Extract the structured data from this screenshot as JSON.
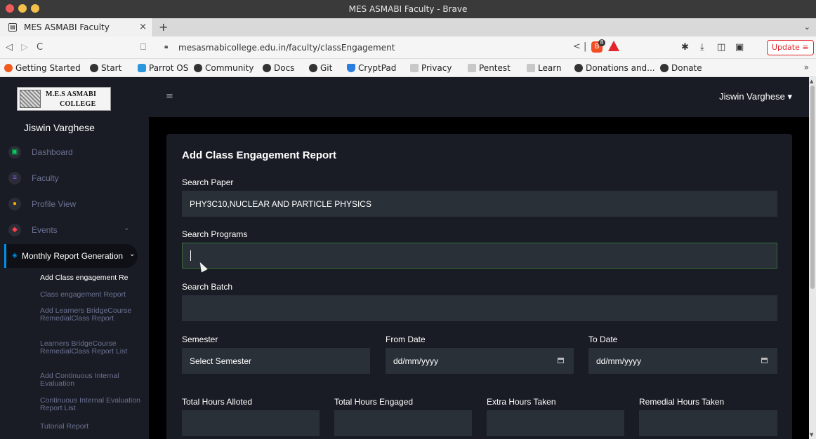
{
  "window": {
    "title": "MES ASMABI Faculty - Brave"
  },
  "tabs": [
    {
      "label": "MES ASMABI Faculty",
      "close": "×"
    }
  ],
  "new_tab_label": "+",
  "tab_menu_icon": "chevron-down-icon",
  "nav": {
    "back": "◁",
    "forward": "▷",
    "reload": "C",
    "bookmark": "⎕",
    "url": "mesasmabicollege.edu.in/faculty/classEngagement",
    "update_label": "Update",
    "shields_count": "8"
  },
  "bookmarks": [
    {
      "label": "Getting Started",
      "icon": "orange"
    },
    {
      "label": "Start",
      "icon": "circ"
    },
    {
      "label": "Parrot OS",
      "icon": "blue"
    },
    {
      "label": "Community",
      "icon": "circ"
    },
    {
      "label": "Docs",
      "icon": "circ"
    },
    {
      "label": "Git",
      "icon": "circ"
    },
    {
      "label": "CryptPad",
      "icon": "shield"
    },
    {
      "label": "Privacy",
      "icon": "fold"
    },
    {
      "label": "Pentest",
      "icon": "fold"
    },
    {
      "label": "Learn",
      "icon": "fold"
    },
    {
      "label": "Donations and...",
      "icon": "circ"
    },
    {
      "label": "Donate",
      "icon": "circ"
    }
  ],
  "bookmarks_more": "»",
  "sidebar": {
    "logo_line1": "M.E.S ASMABI",
    "logo_line2": "COLLEGE",
    "user": "Jiswin Varghese",
    "menu": [
      {
        "label": "Dashboard",
        "icon": "dashboard-icon"
      },
      {
        "label": "Faculty",
        "icon": "list-icon"
      },
      {
        "label": "Profile View",
        "icon": "profile-icon"
      },
      {
        "label": "Events",
        "icon": "events-icon",
        "chevron": "⌄"
      },
      {
        "label": "Monthly Report Generation",
        "icon": "report-icon",
        "chevron": "⌄"
      }
    ],
    "submenu": [
      "Add Class engagement Re",
      "Class engagement Report",
      "Add Learners BridgeCourse RemedialClass Report",
      "Learners BridgeCourse RemedialClass Report List",
      "Add Continuous Internal Evaluation",
      "Continuous Internal Evaluation Report List",
      "Tutorial Report"
    ]
  },
  "topbar": {
    "user_menu": "Jiswin Varghese ▾",
    "hamburger": "≡"
  },
  "form": {
    "title": "Add Class Engagement Report",
    "search_paper_label": "Search Paper",
    "search_paper_value": "PHY3C10,NUCLEAR AND PARTICLE PHYSICS",
    "search_programs_label": "Search Programs",
    "search_programs_value": "",
    "search_batch_label": "Search Batch",
    "search_batch_value": "",
    "semester_label": "Semester",
    "semester_value": "Select Semester",
    "from_date_label": "From Date",
    "from_date_value": "dd/mm/yyyy",
    "to_date_label": "To Date",
    "to_date_value": "dd/mm/yyyy",
    "total_hours_alloted_label": "Total Hours Alloted",
    "total_hours_engaged_label": "Total Hours Engaged",
    "extra_hours_label": "Extra Hours Taken",
    "remedial_hours_label": "Remedial Hours Taken"
  },
  "colors": {
    "sidebar_bg": "#191c24",
    "field_bg": "#2a3038",
    "active_accent": "#0090e7",
    "focus_border": "#336d36"
  }
}
